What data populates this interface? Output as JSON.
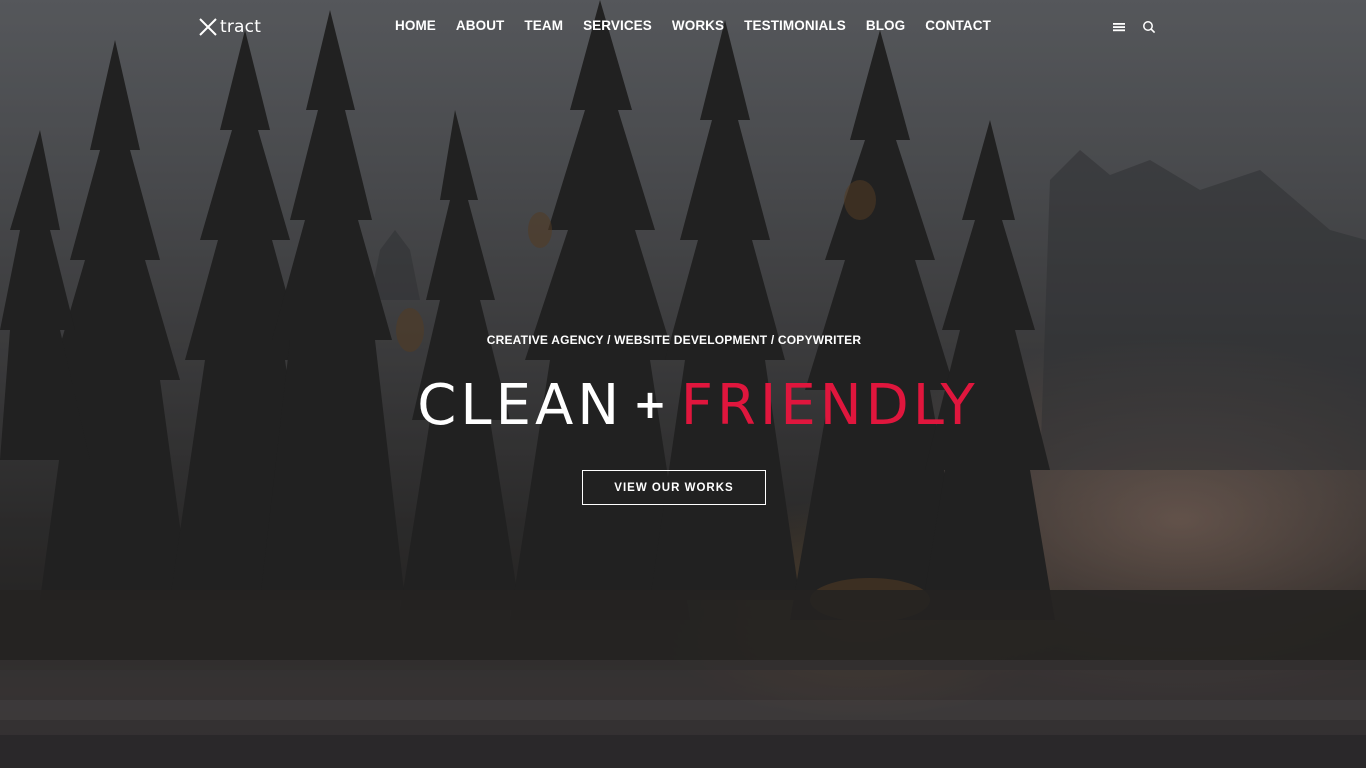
{
  "header": {
    "logo_text": "tract",
    "nav": [
      {
        "label": "HOME"
      },
      {
        "label": "ABOUT"
      },
      {
        "label": "TEAM"
      },
      {
        "label": "SERVICES"
      },
      {
        "label": "WORKS"
      },
      {
        "label": "TESTIMONIALS"
      },
      {
        "label": "BLOG"
      },
      {
        "label": "CONTACT"
      }
    ],
    "icons": [
      "menu-icon",
      "search-icon"
    ]
  },
  "hero": {
    "tagline": "CREATIVE AGENCY / WEBSITE DEVELOPMENT / COPYWRITER",
    "headline_part1": "CLEAN",
    "headline_plus": "+",
    "headline_part2": "FRIENDLY",
    "cta_label": "VIEW OUR WORKS"
  },
  "colors": {
    "accent": "#e0163d",
    "text": "#ffffff"
  }
}
